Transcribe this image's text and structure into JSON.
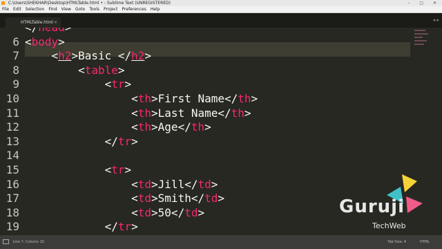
{
  "window": {
    "title": "C:\\Users\\SHEKHAR\\Desktop\\HTMLTable.html • - Sublime Text (UNREGISTERED)",
    "controls": "–  ▢  ✕"
  },
  "menu": [
    "File",
    "Edit",
    "Selection",
    "Find",
    "View",
    "Goto",
    "Tools",
    "Project",
    "Preferences",
    "Help"
  ],
  "tab": {
    "label": "HTMLTable.html",
    "close": "×"
  },
  "tab_arrows": "◂ ▸",
  "editor": {
    "current_line": "7",
    "lines": [
      {
        "num": "",
        "indent": "",
        "tokens": [
          "</",
          "head",
          ">"
        ]
      },
      {
        "num": "6",
        "indent": "",
        "tokens": [
          "<",
          "body",
          ">"
        ]
      },
      {
        "num": "7",
        "indent": "    ",
        "tokens": [
          "<",
          "h2",
          ">Basic </",
          "h2",
          ">"
        ]
      },
      {
        "num": "8",
        "indent": "        ",
        "tokens": [
          "<",
          "table",
          ">"
        ]
      },
      {
        "num": "9",
        "indent": "            ",
        "tokens": [
          "<",
          "tr",
          ">"
        ]
      },
      {
        "num": "10",
        "indent": "                ",
        "tokens": [
          "<",
          "th",
          ">First Name</",
          "th",
          ">"
        ]
      },
      {
        "num": "11",
        "indent": "                ",
        "tokens": [
          "<",
          "th",
          ">Last Name</",
          "th",
          ">"
        ]
      },
      {
        "num": "12",
        "indent": "                ",
        "tokens": [
          "<",
          "th",
          ">Age</",
          "th",
          ">"
        ]
      },
      {
        "num": "13",
        "indent": "            ",
        "tokens": [
          "</",
          "tr",
          ">"
        ]
      },
      {
        "num": "14",
        "indent": "",
        "tokens": []
      },
      {
        "num": "15",
        "indent": "            ",
        "tokens": [
          "<",
          "tr",
          ">"
        ]
      },
      {
        "num": "16",
        "indent": "                ",
        "tokens": [
          "<",
          "td",
          ">Jill</",
          "td",
          ">"
        ]
      },
      {
        "num": "17",
        "indent": "                ",
        "tokens": [
          "<",
          "td",
          ">Smith</",
          "td",
          ">"
        ]
      },
      {
        "num": "18",
        "indent": "                ",
        "tokens": [
          "<",
          "td",
          ">50</",
          "td",
          ">"
        ]
      },
      {
        "num": "19",
        "indent": "            ",
        "tokens": [
          "</",
          "tr",
          ">"
        ]
      }
    ]
  },
  "status": {
    "position": "Line 7, Column 15",
    "tab_size": "Tab Size: 4",
    "syntax": "HTML"
  },
  "watermark": {
    "brand": "Guruji",
    "sub": "TechWeb",
    "colors": {
      "yellow": "#f6d23a",
      "teal": "#3fc1c9",
      "pink": "#ef5b8a"
    }
  }
}
